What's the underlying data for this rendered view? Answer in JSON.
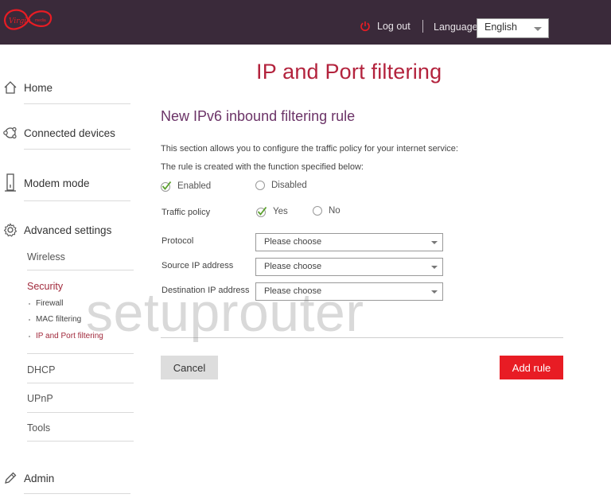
{
  "header": {
    "logout_label": "Log out",
    "language_label": "Language",
    "language_value": "English",
    "colors": {
      "background": "#3a2a3a",
      "brand": "#e81c24"
    }
  },
  "sidebar": {
    "items": [
      {
        "label": "Home",
        "icon": "house-icon"
      },
      {
        "label": "Connected devices",
        "icon": "devices-icon"
      },
      {
        "label": "Modem mode",
        "icon": "modem-icon"
      },
      {
        "label": "Advanced settings",
        "icon": "gear-icon"
      },
      {
        "label": "Admin",
        "icon": "pencil-icon"
      }
    ],
    "advanced": {
      "wireless": "Wireless",
      "security": "Security",
      "security_items": [
        "Firewall",
        "MAC filtering",
        "IP and Port filtering"
      ],
      "dhcp": "DHCP",
      "upnp": "UPnP",
      "tools": "Tools"
    }
  },
  "main": {
    "page_title": "IP and Port filtering",
    "section_title": "New IPv6 inbound filtering rule",
    "desc1": "This section allows you to configure the traffic policy for your internet service:",
    "desc2": "The rule is created with the function specified below:",
    "enabled_label": "Enabled",
    "disabled_label": "Disabled",
    "enabled_selected": true,
    "traffic_policy_label": "Traffic policy",
    "yes_label": "Yes",
    "no_label": "No",
    "traffic_policy_selected": "Yes",
    "protocol_label": "Protocol",
    "protocol_value": "Please choose",
    "source_ip_label": "Source IP address",
    "source_ip_value": "Please choose",
    "dest_ip_label": "Destination IP address",
    "dest_ip_value": "Please choose",
    "cancel_label": "Cancel",
    "add_rule_label": "Add rule"
  },
  "watermark": "setuprouter"
}
